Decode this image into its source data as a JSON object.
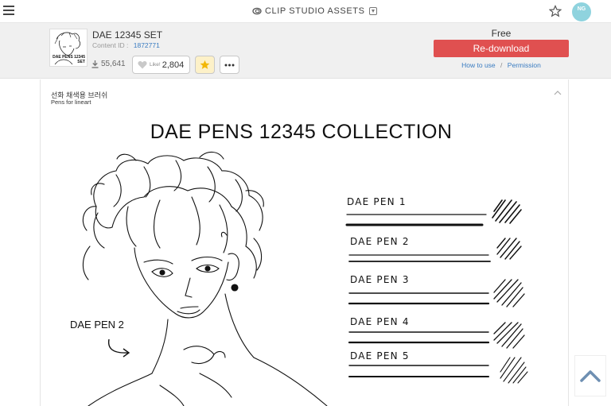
{
  "header": {
    "brand": "CLIP STUDIO ASSETS",
    "avatar_text": "NG"
  },
  "asset": {
    "title": "DAE 12345 SET",
    "content_id_label": "Content ID :",
    "content_id": "1872771",
    "downloads": "55,641",
    "like_label": "Like!",
    "likes": "2,804",
    "thumb_caption": "DAE PENS 12345 SET",
    "price": "Free",
    "redownload_label": "Re-download",
    "how_to_use": "How to use",
    "separator": "/",
    "permission": "Permission"
  },
  "description": {
    "korean": "선화 채색용 브러쉬",
    "english": "Pens for lineart"
  },
  "preview": {
    "title": "DAE PENS 12345 COLLECTION",
    "pens": [
      {
        "label": "DAE PEN 1"
      },
      {
        "label": "DAE PEN 2"
      },
      {
        "label": "DAE PEN 3"
      },
      {
        "label": "DAE PEN 4"
      },
      {
        "label": "DAE PEN 5"
      }
    ],
    "sketch_label": "DAE PEN 2"
  },
  "colors": {
    "accent_red": "#e05050",
    "link_blue": "#3a7cc1",
    "star_gold": "#f2b705"
  }
}
